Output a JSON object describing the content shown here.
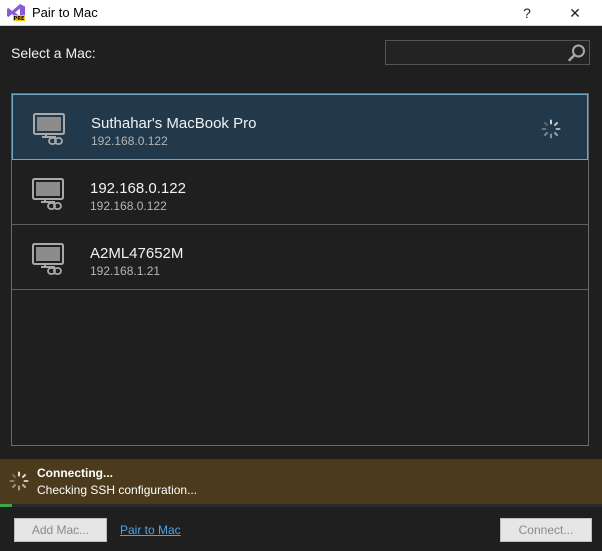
{
  "window": {
    "title": "Pair to Mac",
    "help_glyph": "?",
    "close_glyph": "✕",
    "app_icon": "visual-studio-preview-icon"
  },
  "header": {
    "select_label": "Select a Mac:",
    "search": {
      "value": "",
      "placeholder": "",
      "icon": "search-icon"
    }
  },
  "macs": [
    {
      "name": "Suthahar's MacBook Pro",
      "ip": "192.168.0.122",
      "selected": true,
      "connecting": true,
      "icon": "mac-computer-icon"
    },
    {
      "name": "192.168.0.122",
      "ip": "192.168.0.122",
      "selected": false,
      "connecting": false,
      "icon": "mac-computer-icon"
    },
    {
      "name": "A2ML47652M",
      "ip": "192.168.1.21",
      "selected": false,
      "connecting": false,
      "icon": "mac-computer-icon"
    }
  ],
  "status": {
    "title": "Connecting...",
    "detail": "Checking SSH configuration...",
    "progress": 0.02,
    "colors": {
      "background": "#4b3a1b",
      "progress": "#3aa64a"
    }
  },
  "footer": {
    "add_mac_label": "Add Mac...",
    "pair_link_label": "Pair to Mac",
    "connect_label": "Connect..."
  },
  "colors": {
    "window_background": "#1f1f1f",
    "selected_background": "#21394a",
    "selected_border": "#6fa6c4",
    "link": "#4ea3e8"
  }
}
